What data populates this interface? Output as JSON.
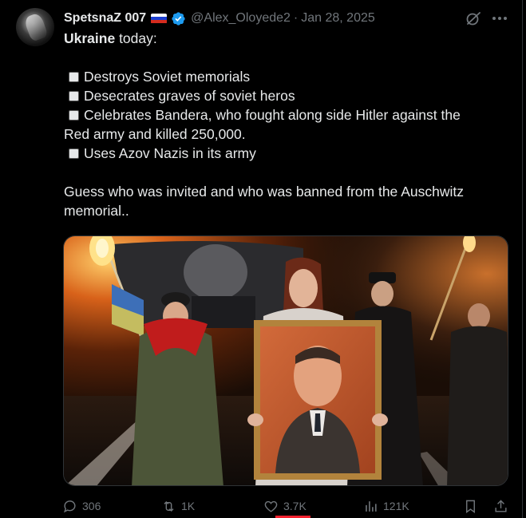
{
  "author": {
    "display_name": "SpetsnaZ 007",
    "handle": "@Alex_Oloyede2",
    "separator": "·",
    "date": "Jan 28, 2025",
    "flag": "russia-flag",
    "verified": true
  },
  "post": {
    "lead_bold": "Ukraine",
    "lead_rest": " today:",
    "items": [
      "Destroys Soviet memorials",
      "Desecrates graves of soviet heros",
      "Celebrates Bandera, who fought along side Hitler against the",
      "Red army and killed 250,000.",
      "Uses Azov Nazis in its army"
    ],
    "closing_line1": "Guess who was invited and who was banned from the Auschwitz",
    "closing_line2": "memorial.."
  },
  "metrics": {
    "replies": "306",
    "reposts": "1K",
    "likes": "3.7K",
    "views": "121K"
  },
  "icons": {
    "grok": "grok-icon",
    "more": "more-icon",
    "reply": "reply-icon",
    "repost": "repost-icon",
    "like": "heart-icon",
    "views": "views-icon",
    "bookmark": "bookmark-icon",
    "share": "share-icon"
  },
  "colors": {
    "background": "#000000",
    "text": "#e7e9ea",
    "muted": "#71767b",
    "verified": "#1d9bf0",
    "active_tab": "#f4212e"
  }
}
